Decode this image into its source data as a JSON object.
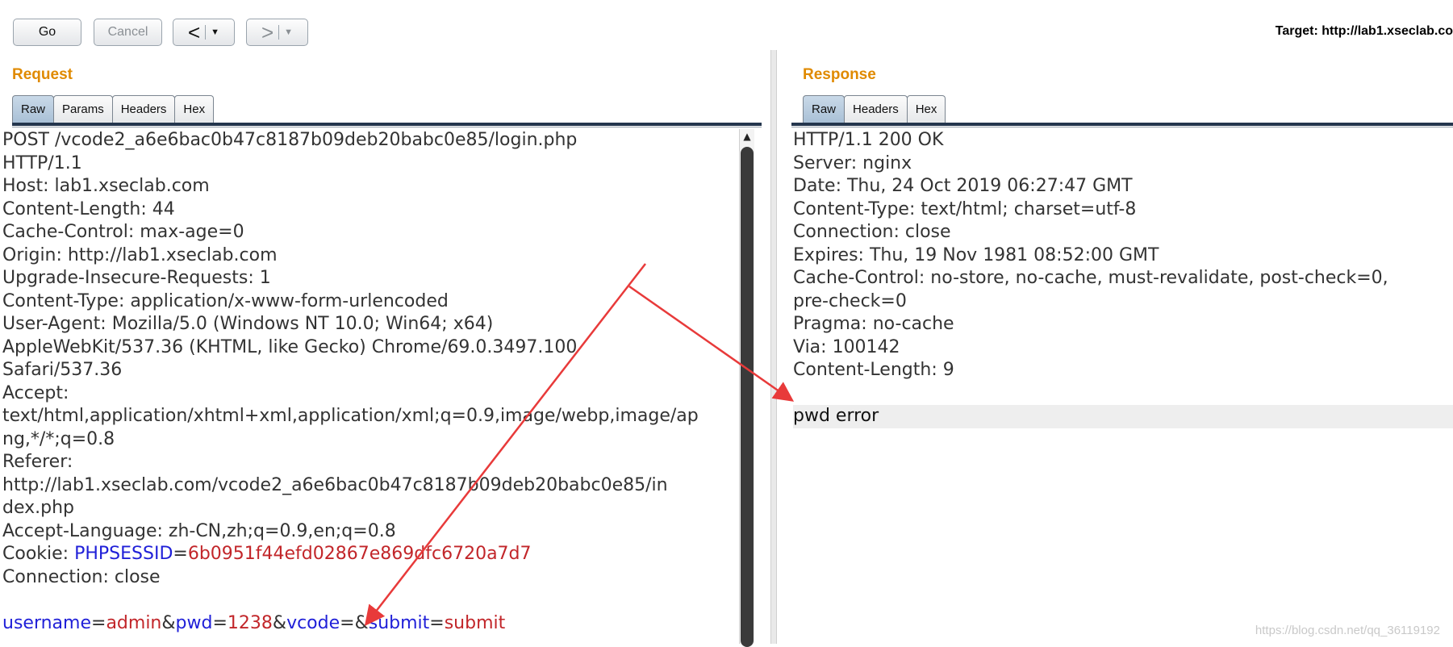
{
  "toolbar": {
    "go_label": "Go",
    "cancel_label": "Cancel",
    "back_arrow": "<",
    "forward_arrow": ">",
    "dropdown_glyph": "▼",
    "target_label": "Target: http://lab1.xseclab.co"
  },
  "request": {
    "title": "Request",
    "tabs": [
      {
        "label": "Raw",
        "active": true
      },
      {
        "label": "Params",
        "active": false
      },
      {
        "label": "Headers",
        "active": false
      },
      {
        "label": "Hex",
        "active": false
      }
    ],
    "lines": [
      "POST /vcode2_a6e6bac0b47c8187b09deb20babc0e85/login.php",
      "HTTP/1.1",
      "Host: lab1.xseclab.com",
      "Content-Length: 44",
      "Cache-Control: max-age=0",
      "Origin: http://lab1.xseclab.com",
      "Upgrade-Insecure-Requests: 1",
      "Content-Type: application/x-www-form-urlencoded",
      "User-Agent: Mozilla/5.0 (Windows NT 10.0; Win64; x64)",
      "AppleWebKit/537.36 (KHTML, like Gecko) Chrome/69.0.3497.100",
      "Safari/537.36",
      "Accept:",
      "text/html,application/xhtml+xml,application/xml;q=0.9,image/webp,image/ap",
      "ng,*/*;q=0.8",
      "Referer:",
      "http://lab1.xseclab.com/vcode2_a6e6bac0b47c8187b09deb20babc0e85/in",
      "dex.php",
      "Accept-Language: zh-CN,zh;q=0.9,en;q=0.8"
    ],
    "cookie": {
      "prefix": "Cookie: ",
      "name": "PHPSESSID",
      "eq": "=",
      "value": "6b0951f44efd02867e869dfc6720a7d7"
    },
    "connection_line": "Connection: close",
    "body": {
      "k1": "username",
      "eq1": "=",
      "v1": "admin",
      "amp1": "&",
      "k2": "pwd",
      "eq2": "=",
      "v2": "1238",
      "amp2": "&",
      "k3": "vcode",
      "eq3": "=",
      "amp3": "&",
      "k4": "submit",
      "eq4": "=",
      "v4": "submit"
    }
  },
  "response": {
    "title": "Response",
    "tabs": [
      {
        "label": "Raw",
        "active": true
      },
      {
        "label": "Headers",
        "active": false
      },
      {
        "label": "Hex",
        "active": false
      }
    ],
    "lines": [
      "HTTP/1.1 200 OK",
      "Server: nginx",
      "Date: Thu, 24 Oct 2019 06:27:47 GMT",
      "Content-Type: text/html; charset=utf-8",
      "Connection: close",
      "Expires: Thu, 19 Nov 1981 08:52:00 GMT",
      "Cache-Control: no-store, no-cache, must-revalidate, post-check=0,",
      "pre-check=0",
      "Pragma: no-cache",
      "Via: 100142",
      "Content-Length: 9"
    ],
    "body": "pwd error"
  },
  "watermark": "https://blog.csdn.net/qq_36119192",
  "colors": {
    "section_title": "#e08a00",
    "param_name": "#2020d8",
    "param_value": "#c2262a",
    "annotation_arrow": "#e83a3a"
  }
}
